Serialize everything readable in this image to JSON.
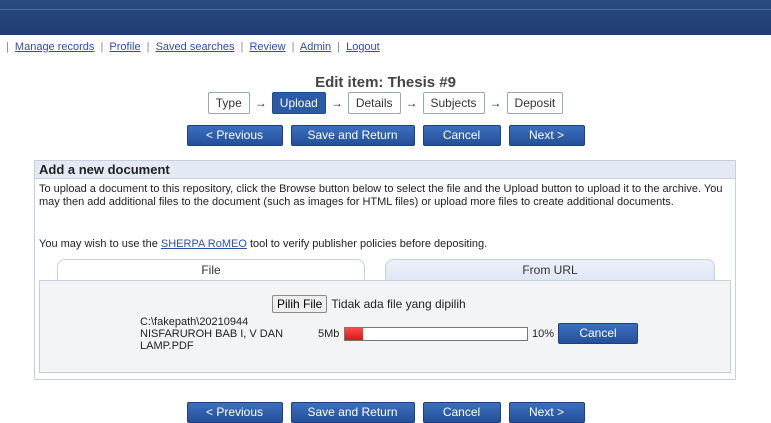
{
  "nav": {
    "items": [
      "Manage records",
      "Profile",
      "Saved searches",
      "Review",
      "Admin",
      "Logout"
    ]
  },
  "page": {
    "title": "Edit item: Thesis #9"
  },
  "workflow": {
    "steps": [
      "Type",
      "Upload",
      "Details",
      "Subjects",
      "Deposit"
    ],
    "active_step": "Upload"
  },
  "buttons": {
    "previous": "< Previous",
    "save_return": "Save and Return",
    "cancel": "Cancel",
    "next": "Next >"
  },
  "panel": {
    "title": "Add a new document",
    "intro": "To upload a document to this repository, click the Browse button below to select the file and the Upload button to upload it to the archive. You may then add additional files to the document (such as images for HTML files) or upload more files to create additional documents.",
    "sherpa_prefix": "You may wish to use the ",
    "sherpa_link": "SHERPA RoMEO",
    "sherpa_suffix": " tool to verify publisher policies before depositing.",
    "tabs": [
      "File",
      "From URL"
    ],
    "choose_button": "Pilih File",
    "no_file_text": "Tidak ada file yang dipilih",
    "upload": {
      "filename": "C:\\fakepath\\20210944 NISFARUROH BAB I, V DAN LAMP.PDF",
      "size": "5Mb",
      "progress": 0.1,
      "percent_label": "10%",
      "cancel_label": "Cancel"
    }
  },
  "colors": {
    "header_bar": "#1f3d70",
    "accent_button": "#2d5aa6",
    "link": "#2f4fa6",
    "progress_fill": "#d11a1a"
  }
}
